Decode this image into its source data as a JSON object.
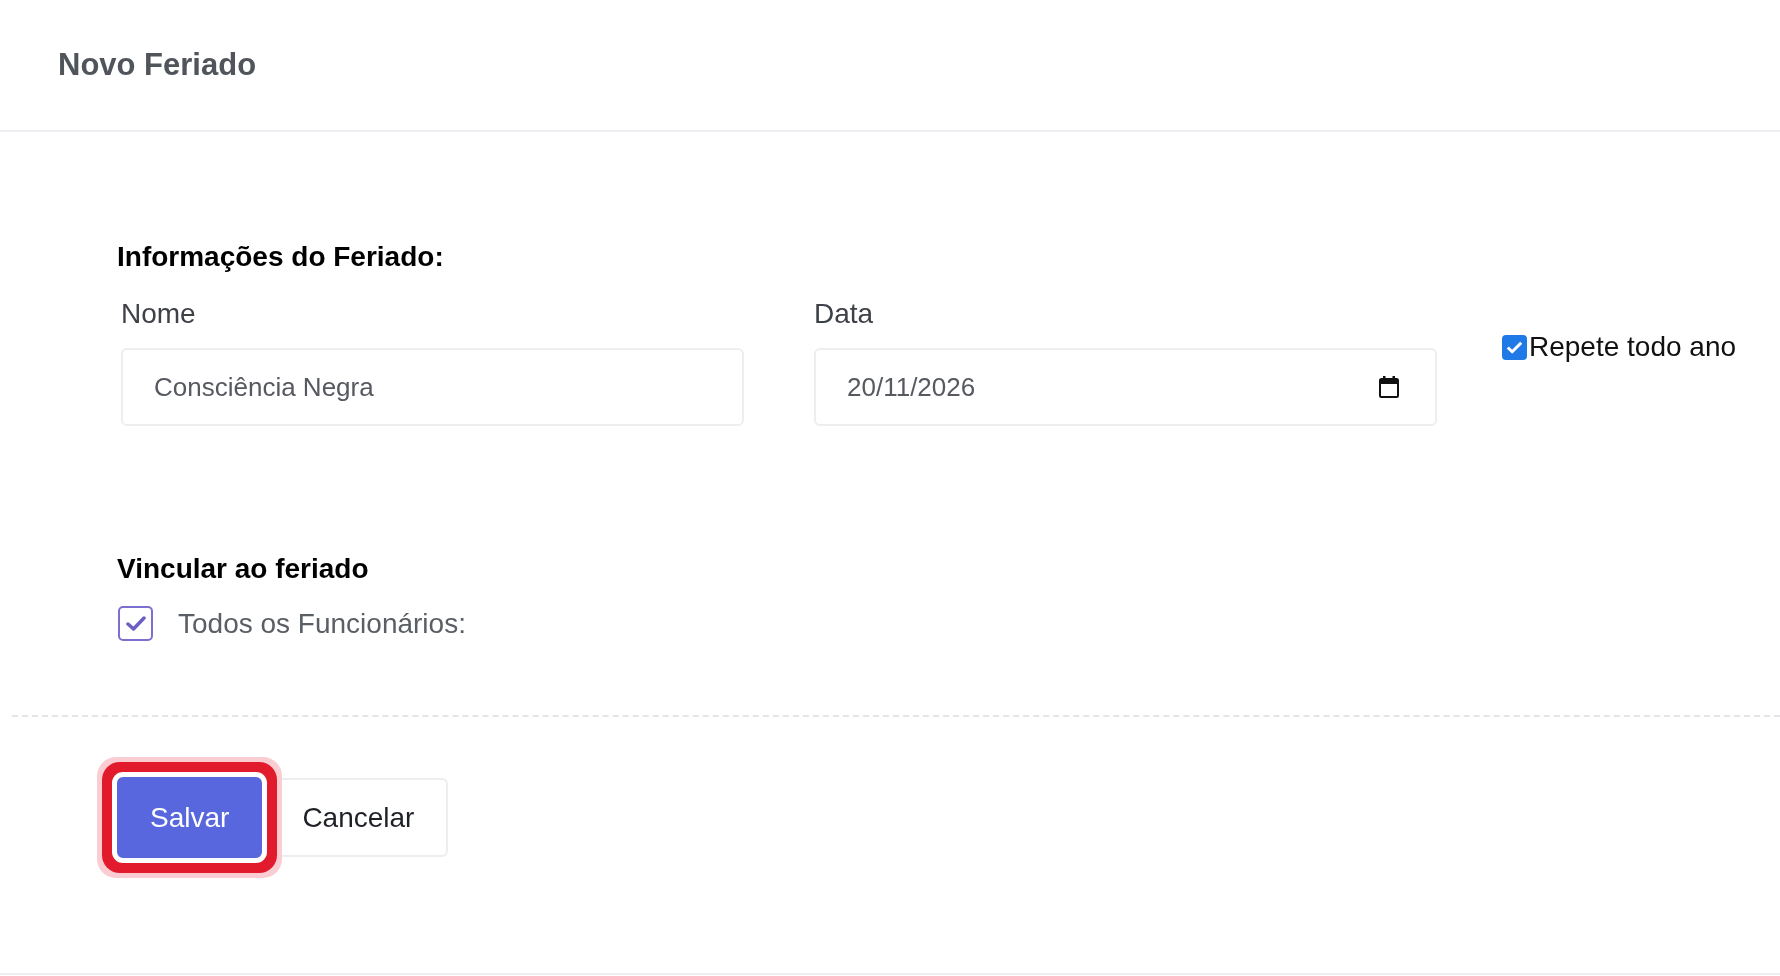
{
  "header": {
    "title": "Novo Feriado"
  },
  "holiday_info": {
    "heading": "Informações do Feriado:",
    "fields": [
      {
        "kind": "text",
        "label": "Nome",
        "value": "Consciência Negra"
      },
      {
        "kind": "date",
        "label": "Data",
        "value": "20/11/2026"
      }
    ],
    "repeat_checkbox": {
      "label": "Repete todo ano",
      "checked": true
    }
  },
  "link_section": {
    "heading": "Vincular ao feriado",
    "options": [
      {
        "label": "Todos os Funcionários:",
        "checked": true
      }
    ]
  },
  "buttons": [
    {
      "kind": "primary",
      "label": "Salvar",
      "focused": true
    },
    {
      "kind": "secondary",
      "label": "Cancelar",
      "focused": false
    }
  ]
}
